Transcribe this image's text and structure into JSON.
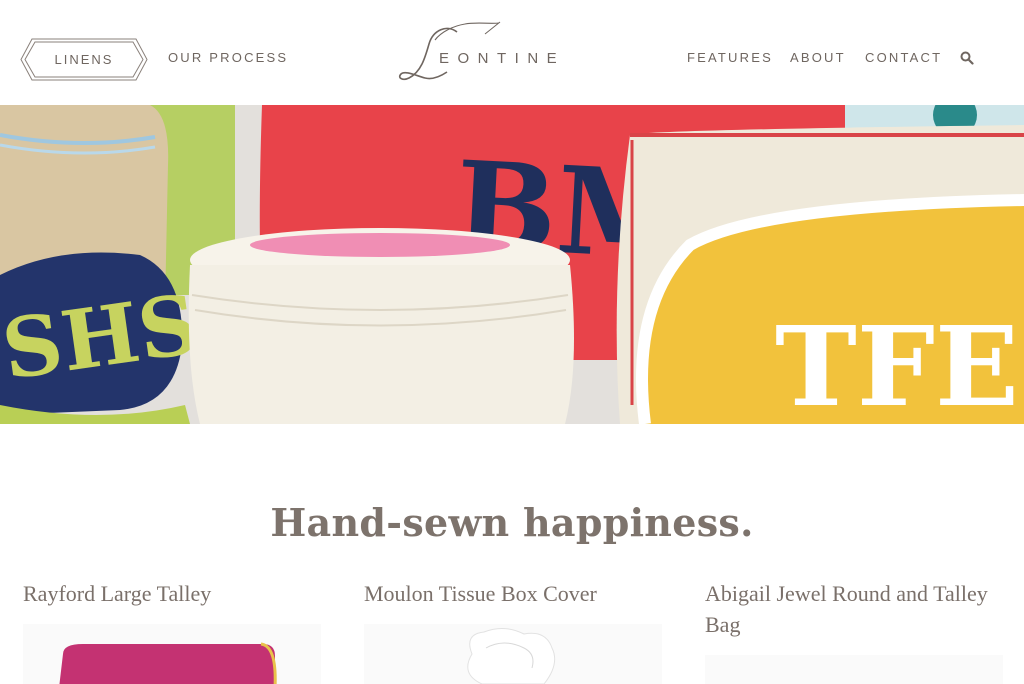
{
  "header": {
    "linens_label": "LINENS",
    "our_process_label": "OUR PROCESS",
    "logo_letter": "L",
    "logo_text": "EONTINE",
    "nav": [
      "FEATURES",
      "ABOUT",
      "CONTACT"
    ],
    "search_icon": "search-icon"
  },
  "hero": {
    "monograms": [
      "BMI",
      "SHS",
      "TFE"
    ]
  },
  "main": {
    "headline": "Hand-sewn happiness."
  },
  "products": [
    {
      "title": "Rayford Large Talley"
    },
    {
      "title": "Moulon Tissue Box Cover"
    },
    {
      "title": "Abigail Jewel Round and Talley Bag"
    }
  ],
  "colors": {
    "text": "#7a706a",
    "hero_red": "#e8434a",
    "hero_yellow": "#f2c23c",
    "hero_navy": "#1f2f5c",
    "hero_green": "#b9cf55",
    "product_pink": "#c43272"
  }
}
